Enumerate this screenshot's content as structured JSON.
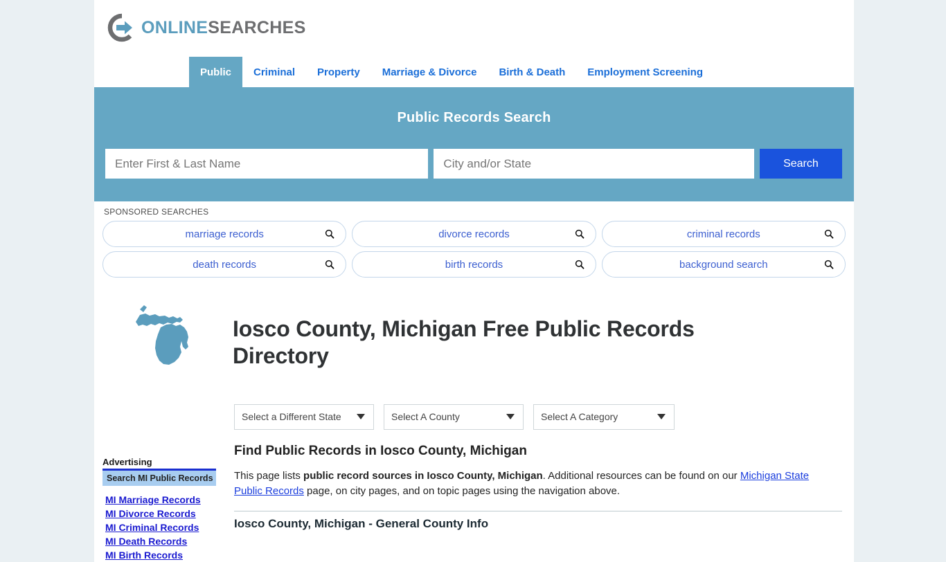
{
  "brand": {
    "name_part1": "ONLINE",
    "name_part2": "SEARCHES",
    "logo_icon": "circle-arrow-icon",
    "accent_blue": "#5b9dbd",
    "accent_gray": "#6d6e70"
  },
  "nav": {
    "items": [
      {
        "label": "Public",
        "active": true
      },
      {
        "label": "Criminal",
        "active": false
      },
      {
        "label": "Property",
        "active": false
      },
      {
        "label": "Marriage & Divorce",
        "active": false
      },
      {
        "label": "Birth & Death",
        "active": false
      },
      {
        "label": "Employment Screening",
        "active": false
      }
    ]
  },
  "banner": {
    "title": "Public Records Search",
    "name_value": "",
    "name_placeholder": "Enter First & Last Name",
    "city_value": "",
    "city_placeholder": "City and/or State",
    "search_button": "Search",
    "background_color": "#65a7c4",
    "button_color": "#1a53dd"
  },
  "sponsored": {
    "label": "SPONSORED SEARCHES",
    "row1": [
      {
        "label": "marriage records",
        "icon": "search-icon"
      },
      {
        "label": "divorce records",
        "icon": "search-icon"
      },
      {
        "label": "criminal records",
        "icon": "search-icon"
      }
    ],
    "row2": [
      {
        "label": "death records",
        "icon": "search-icon"
      },
      {
        "label": "birth records",
        "icon": "search-icon"
      },
      {
        "label": "background search",
        "icon": "search-icon"
      }
    ]
  },
  "hero": {
    "map_icon": "michigan-state-map-icon",
    "map_color": "#5b9dbd",
    "title": "Iosco County, Michigan Free Public Records Directory"
  },
  "selects": {
    "state": "Select a Different State",
    "county": "Select A County",
    "category": "Select A Category"
  },
  "sidebar": {
    "ad_heading": "Advertising",
    "ad_box_label": "Search MI Public Records",
    "links": [
      "MI Marriage Records",
      "MI Divorce Records",
      "MI Criminal Records",
      "MI Death Records",
      "MI Birth Records"
    ]
  },
  "main": {
    "section_title": "Find Public Records in Iosco County, Michigan",
    "para_lead": "This page lists ",
    "para_bold": "public record sources in Iosco County, Michigan",
    "para_mid": ". Additional resources can be found on our ",
    "para_link": "Michigan State Public Records",
    "para_tail": " page, on city pages, and on topic pages using the navigation above.",
    "general_info_title": "Iosco County, Michigan - General County Info"
  }
}
